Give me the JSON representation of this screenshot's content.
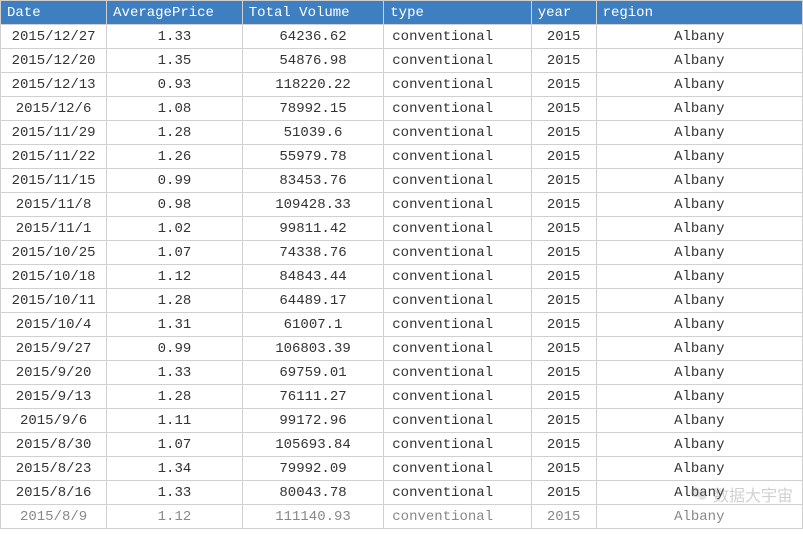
{
  "headers": {
    "date": "Date",
    "price": "AveragePrice",
    "volume": "Total Volume",
    "type": "type",
    "year": "year",
    "region": "region"
  },
  "rows": [
    {
      "date": "2015/12/27",
      "price": "1.33",
      "volume": "64236.62",
      "type": "conventional",
      "year": "2015",
      "region": "Albany"
    },
    {
      "date": "2015/12/20",
      "price": "1.35",
      "volume": "54876.98",
      "type": "conventional",
      "year": "2015",
      "region": "Albany"
    },
    {
      "date": "2015/12/13",
      "price": "0.93",
      "volume": "118220.22",
      "type": "conventional",
      "year": "2015",
      "region": "Albany"
    },
    {
      "date": "2015/12/6",
      "price": "1.08",
      "volume": "78992.15",
      "type": "conventional",
      "year": "2015",
      "region": "Albany"
    },
    {
      "date": "2015/11/29",
      "price": "1.28",
      "volume": "51039.6",
      "type": "conventional",
      "year": "2015",
      "region": "Albany"
    },
    {
      "date": "2015/11/22",
      "price": "1.26",
      "volume": "55979.78",
      "type": "conventional",
      "year": "2015",
      "region": "Albany"
    },
    {
      "date": "2015/11/15",
      "price": "0.99",
      "volume": "83453.76",
      "type": "conventional",
      "year": "2015",
      "region": "Albany"
    },
    {
      "date": "2015/11/8",
      "price": "0.98",
      "volume": "109428.33",
      "type": "conventional",
      "year": "2015",
      "region": "Albany"
    },
    {
      "date": "2015/11/1",
      "price": "1.02",
      "volume": "99811.42",
      "type": "conventional",
      "year": "2015",
      "region": "Albany"
    },
    {
      "date": "2015/10/25",
      "price": "1.07",
      "volume": "74338.76",
      "type": "conventional",
      "year": "2015",
      "region": "Albany"
    },
    {
      "date": "2015/10/18",
      "price": "1.12",
      "volume": "84843.44",
      "type": "conventional",
      "year": "2015",
      "region": "Albany"
    },
    {
      "date": "2015/10/11",
      "price": "1.28",
      "volume": "64489.17",
      "type": "conventional",
      "year": "2015",
      "region": "Albany"
    },
    {
      "date": "2015/10/4",
      "price": "1.31",
      "volume": "61007.1",
      "type": "conventional",
      "year": "2015",
      "region": "Albany"
    },
    {
      "date": "2015/9/27",
      "price": "0.99",
      "volume": "106803.39",
      "type": "conventional",
      "year": "2015",
      "region": "Albany"
    },
    {
      "date": "2015/9/20",
      "price": "1.33",
      "volume": "69759.01",
      "type": "conventional",
      "year": "2015",
      "region": "Albany"
    },
    {
      "date": "2015/9/13",
      "price": "1.28",
      "volume": "76111.27",
      "type": "conventional",
      "year": "2015",
      "region": "Albany"
    },
    {
      "date": "2015/9/6",
      "price": "1.11",
      "volume": "99172.96",
      "type": "conventional",
      "year": "2015",
      "region": "Albany"
    },
    {
      "date": "2015/8/30",
      "price": "1.07",
      "volume": "105693.84",
      "type": "conventional",
      "year": "2015",
      "region": "Albany"
    },
    {
      "date": "2015/8/23",
      "price": "1.34",
      "volume": "79992.09",
      "type": "conventional",
      "year": "2015",
      "region": "Albany"
    },
    {
      "date": "2015/8/16",
      "price": "1.33",
      "volume": "80043.78",
      "type": "conventional",
      "year": "2015",
      "region": "Albany"
    },
    {
      "date": "2015/8/9",
      "price": "1.12",
      "volume": "111140.93",
      "type": "conventional",
      "year": "2015",
      "region": "Albany"
    }
  ],
  "watermark": "数据大宇宙"
}
